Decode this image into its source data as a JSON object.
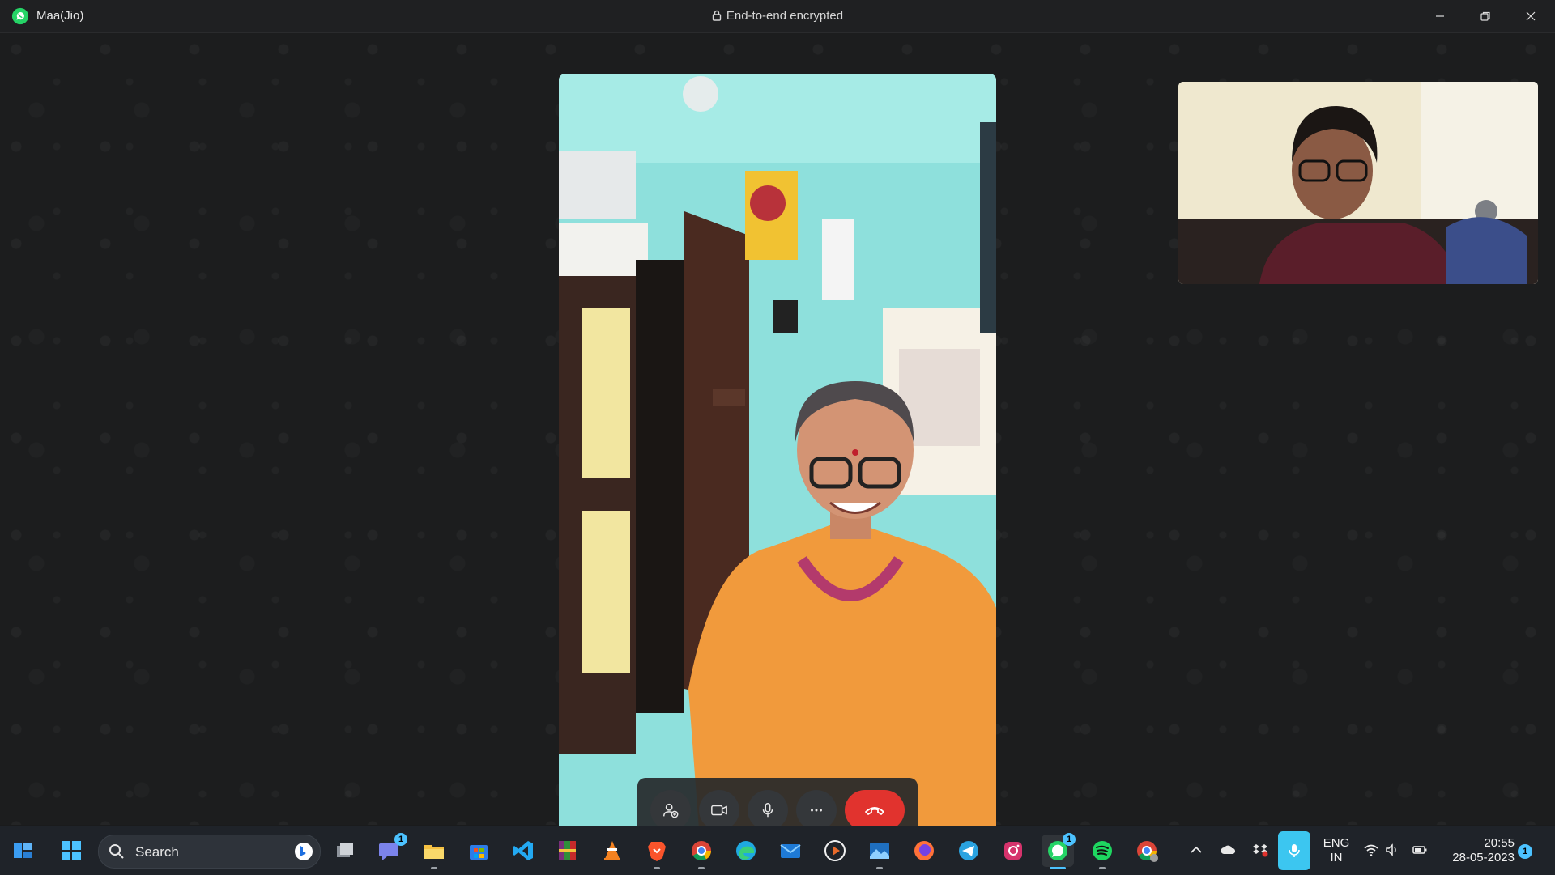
{
  "window": {
    "title": "Maa(Jio)",
    "encryption_label": "End-to-end encrypted",
    "minimize_icon": "minimize-icon",
    "restore_icon": "restore-icon",
    "close_icon": "close-icon"
  },
  "call": {
    "controls": [
      {
        "name": "add-participant-button",
        "icon": "add-person-icon"
      },
      {
        "name": "video-toggle-button",
        "icon": "video-camera-icon"
      },
      {
        "name": "mic-toggle-button",
        "icon": "microphone-icon"
      },
      {
        "name": "more-options-button",
        "icon": "ellipsis-icon"
      },
      {
        "name": "end-call-button",
        "icon": "hang-up-icon",
        "color": "#e1332e"
      }
    ]
  },
  "taskbar": {
    "search_label": "Search",
    "apps": [
      "widgets-icon",
      "start-icon",
      "task-view-icon",
      "teams-chat-icon",
      "file-explorer-icon",
      "microsoft-store-icon",
      "vscode-icon",
      "winrar-icon",
      "vlc-icon",
      "brave-icon",
      "chrome-icon",
      "edge-icon",
      "mail-icon",
      "media-player-icon",
      "photos-icon",
      "firefox-icon",
      "telegram-icon",
      "instagram-icon",
      "whatsapp-icon",
      "spotify-icon",
      "chrome-profile-icon"
    ],
    "teams_badge": "1",
    "whatsapp_badge": "1",
    "language": {
      "line1": "ENG",
      "line2": "IN"
    },
    "clock": {
      "time": "20:55",
      "date": "28-05-2023"
    },
    "notification_count": "1",
    "accent_color": "#4cc2ff"
  }
}
